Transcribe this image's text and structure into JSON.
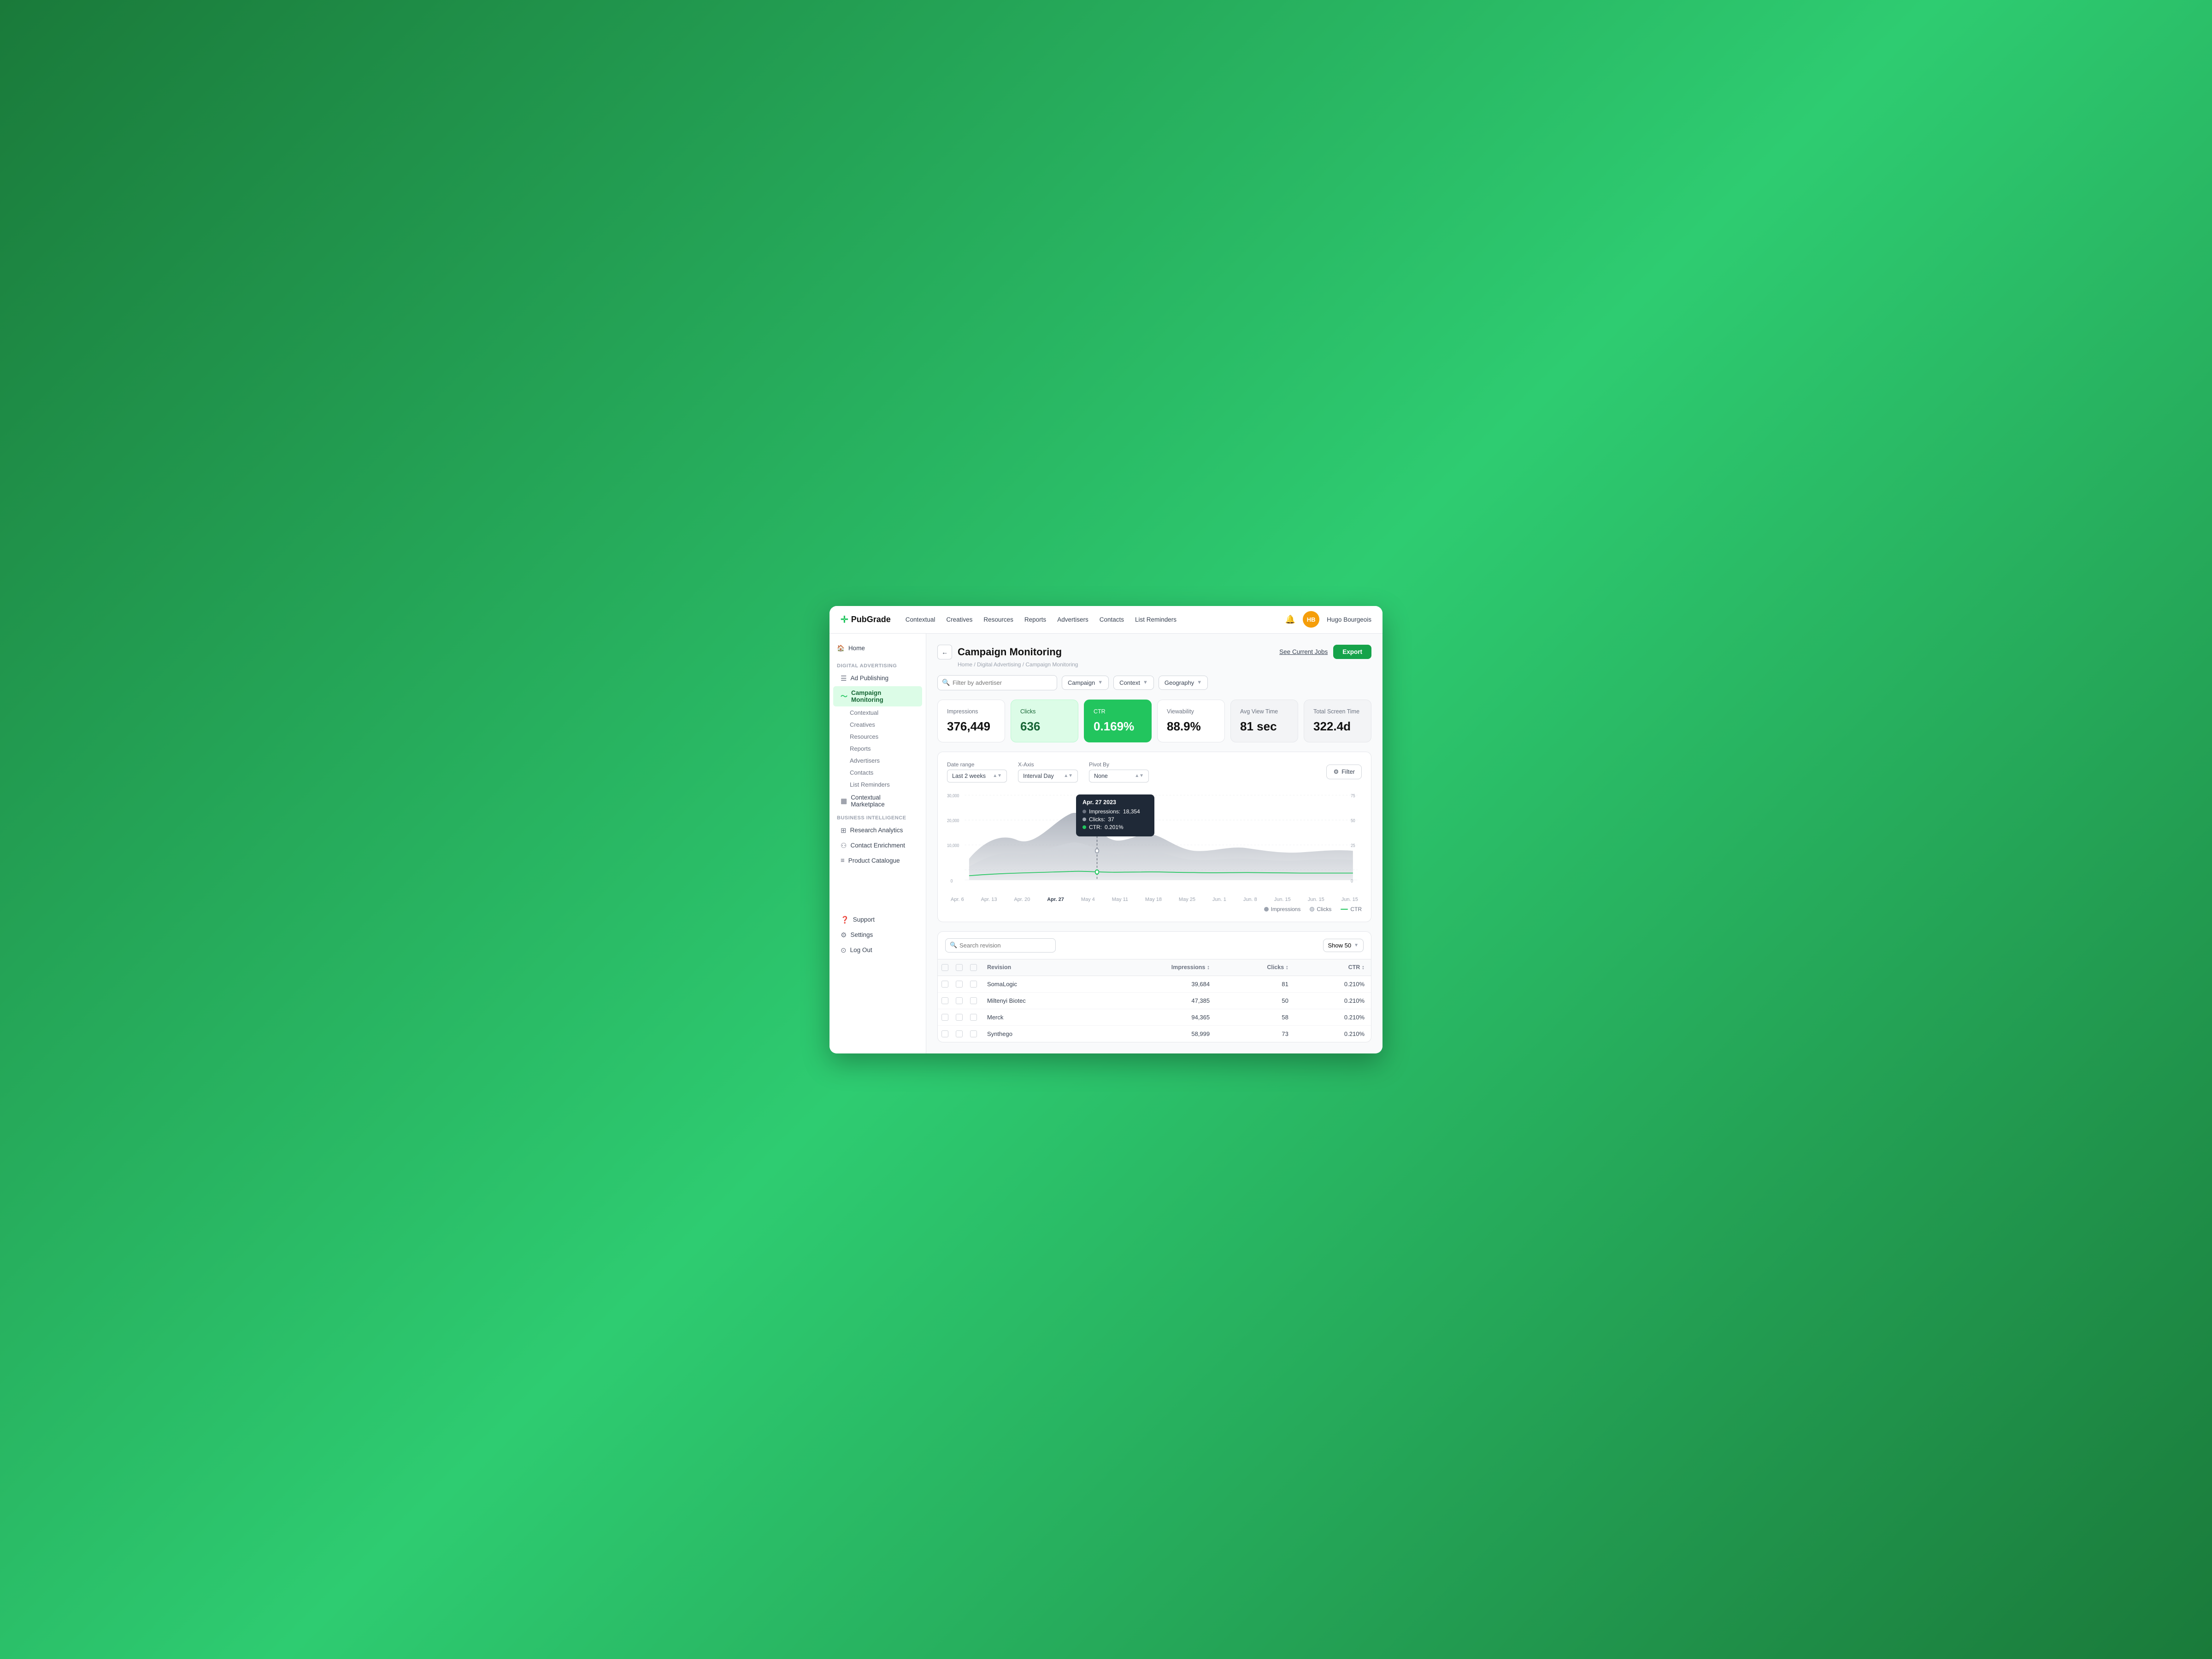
{
  "app": {
    "logo": "PubGrade",
    "logo_symbol": "✛"
  },
  "nav": {
    "links": [
      "Contextual",
      "Creatives",
      "Resources",
      "Reports",
      "Advertisers",
      "Contacts",
      "List Reminders"
    ],
    "bell": "🔔",
    "user_initials": "HB",
    "user_name": "Hugo Bourgeois"
  },
  "sidebar": {
    "home_label": "Home",
    "section1_label": "Digital Advertising",
    "items1": [
      {
        "id": "ad-publishing",
        "label": "Ad Publishing",
        "icon": "☰"
      },
      {
        "id": "campaign-monitoring",
        "label": "Campaign Monitoring",
        "icon": "〜",
        "active": true
      },
      {
        "id": "contextual",
        "label": "Contextual",
        "sub": true
      },
      {
        "id": "creatives",
        "label": "Creatives",
        "sub": true
      },
      {
        "id": "resources",
        "label": "Resources",
        "sub": true
      },
      {
        "id": "reports",
        "label": "Reports",
        "sub": true
      },
      {
        "id": "advertisers",
        "label": "Advertisers",
        "sub": true
      },
      {
        "id": "contacts",
        "label": "Contacts",
        "sub": true
      },
      {
        "id": "list-reminders",
        "label": "List Reminders",
        "sub": true
      },
      {
        "id": "contextual-marketplace",
        "label": "Contextual Marketplace",
        "icon": "▦"
      }
    ],
    "section2_label": "Business Intelligence",
    "items2": [
      {
        "id": "research-analytics",
        "label": "Research Analytics",
        "icon": "⊞"
      },
      {
        "id": "contact-enrichment",
        "label": "Contact Enrichment",
        "icon": "⚇"
      },
      {
        "id": "product-catalogue",
        "label": "Product Catalogue",
        "icon": "≡"
      }
    ],
    "bottom_items": [
      {
        "id": "support",
        "label": "Support",
        "icon": "?"
      },
      {
        "id": "settings",
        "label": "Settings",
        "icon": "⚙"
      },
      {
        "id": "log-out",
        "label": "Log Out",
        "icon": "⊙"
      }
    ]
  },
  "page": {
    "title": "Campaign Monitoring",
    "breadcrumb": "Home / Digital Advertising / Campaign Monitoring",
    "see_jobs": "See Current Jobs",
    "export_btn": "Export"
  },
  "filters": {
    "search_placeholder": "Filter by advertiser",
    "dropdowns": [
      "Campaign",
      "Context",
      "Geography"
    ]
  },
  "stats": [
    {
      "id": "impressions",
      "label": "Impressions",
      "value": "376,449",
      "type": "normal"
    },
    {
      "id": "clicks",
      "label": "Clicks",
      "value": "636",
      "type": "light-green"
    },
    {
      "id": "ctr",
      "label": "CTR",
      "value": "0.169%",
      "type": "green"
    },
    {
      "id": "viewability",
      "label": "Viewability",
      "value": "88.9%",
      "type": "normal"
    },
    {
      "id": "avg-view-time",
      "label": "Avg View Time",
      "value": "81 sec",
      "type": "gray"
    },
    {
      "id": "total-screen-time",
      "label": "Total Screen Time",
      "value": "322.4d",
      "type": "gray"
    }
  ],
  "chart": {
    "date_range_label": "Date range",
    "date_range_value": "Last 2 weeks",
    "x_axis_label": "X-Axis",
    "x_axis_value": "Interval Day",
    "pivot_label": "Pivot By",
    "pivot_value": "None",
    "filter_btn": "Filter",
    "x_labels": [
      "Apr. 6",
      "Apr. 13",
      "Apr. 20",
      "Apr. 27",
      "May 4",
      "May 11",
      "May 18",
      "May 25",
      "Jun. 1",
      "Jun. 8",
      "Jun. 15",
      "Jun. 15",
      "Jun. 15"
    ],
    "y_left_labels": [
      "0",
      "10,000",
      "20,000",
      "30,000"
    ],
    "y_right_labels": [
      "0",
      "25",
      "50",
      "75"
    ],
    "tooltip": {
      "date": "Apr. 27 2023",
      "impressions_label": "Impressions:",
      "impressions_value": "18,354",
      "clicks_label": "Clicks:",
      "clicks_value": "37",
      "ctr_label": "CTR:",
      "ctr_value": "0.201%"
    },
    "legend": [
      {
        "id": "impressions",
        "label": "Impressions",
        "type": "area",
        "color": "#9ca3af"
      },
      {
        "id": "clicks",
        "label": "Clicks",
        "type": "area",
        "color": "#d1d5db"
      },
      {
        "id": "ctr",
        "label": "CTR",
        "type": "line",
        "color": "#22c55e"
      }
    ]
  },
  "table": {
    "search_placeholder": "Search revision",
    "show_label": "Show 50",
    "columns": [
      {
        "id": "revision",
        "label": "Revision"
      },
      {
        "id": "impressions",
        "label": "Impressions ↕",
        "align": "right"
      },
      {
        "id": "clicks",
        "label": "Clicks ↕",
        "align": "right"
      },
      {
        "id": "ctr",
        "label": "CTR ↕",
        "align": "right"
      }
    ],
    "rows": [
      {
        "revision": "SomaLogic",
        "impressions": "39,684",
        "clicks": "81",
        "ctr": "0.210%"
      },
      {
        "revision": "Miltenyi Biotec",
        "impressions": "47,385",
        "clicks": "50",
        "ctr": "0.210%"
      },
      {
        "revision": "Merck",
        "impressions": "94,365",
        "clicks": "58",
        "ctr": "0.210%"
      },
      {
        "revision": "Synthego",
        "impressions": "58,999",
        "clicks": "73",
        "ctr": "0.210%"
      }
    ]
  }
}
